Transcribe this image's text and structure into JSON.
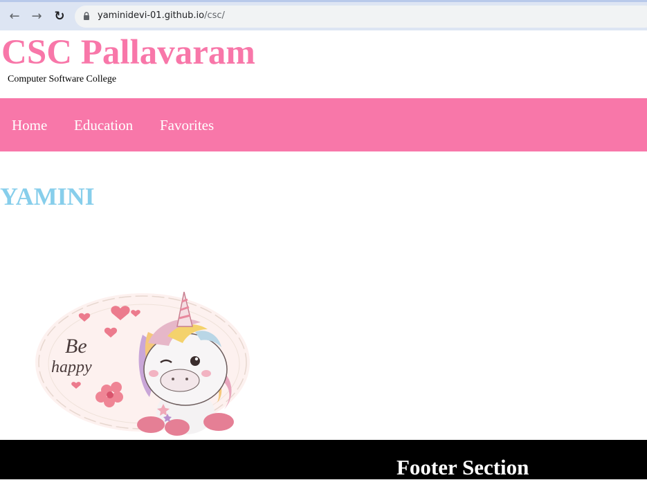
{
  "browser": {
    "back_icon": "arrow-left-icon",
    "forward_icon": "arrow-right-icon",
    "reload_icon": "reload-icon",
    "lock_icon": "lock-icon",
    "url_host": "yaminidevi-01.github.io",
    "url_path": "/csc/"
  },
  "header": {
    "title": "CSC Pallavaram",
    "subtitle": "Computer Software College"
  },
  "nav": {
    "items": [
      {
        "label": "Home"
      },
      {
        "label": "Education"
      },
      {
        "label": "Favorites"
      }
    ]
  },
  "main": {
    "name": "YAMINI",
    "image": {
      "text_line1": "Be",
      "text_line2": "happy"
    }
  },
  "footer": {
    "title": "Footer Section"
  },
  "colors": {
    "accent_pink": "#f877a9",
    "name_blue": "#87ceeb",
    "footer_bg": "#000000"
  }
}
